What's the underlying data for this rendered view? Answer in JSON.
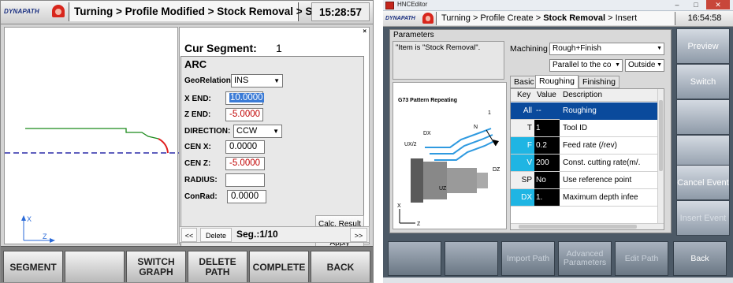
{
  "left": {
    "logo": "DYNAPATH",
    "breadcrumb": "Turning > Profile Modified > Stock Removal > Save",
    "clock": "15:28:57",
    "close": "×",
    "segment": {
      "label": "Cur Segment:",
      "value": "1"
    },
    "form": {
      "type": "ARC",
      "geo_label": "GeoRelation:",
      "geo_value": "INS",
      "xend_label": "X END:",
      "xend_value": "10.0000",
      "zend_label": "Z END:",
      "zend_value": "-5.0000",
      "dir_label": "DIRECTION:",
      "dir_value": "CCW",
      "cenx_label": "CEN X:",
      "cenx_value": "0.0000",
      "cenz_label": "CEN Z:",
      "cenz_value": "-5.0000",
      "radius_label": "RADIUS:",
      "radius_value": "",
      "conrad_label": "ConRad:",
      "conrad_value": "0.0000",
      "calc_button": "Calc. Result",
      "apply_button": "Apply"
    },
    "segnav": {
      "prev": "<<",
      "delete": "Delete",
      "seg": "Seg.:1/10",
      "next": ">>"
    },
    "axes": {
      "x": "X",
      "z": "Z"
    },
    "fkeys": [
      "SEGMENT",
      "",
      "SWITCH\nGRAPH",
      "DELETE\nPATH",
      "COMPLETE",
      "BACK"
    ]
  },
  "right": {
    "window_title": "HNCEditor",
    "logo": "DYNAPATH",
    "breadcrumb_pre": "Turning > Profile Create > ",
    "breadcrumb_bold": "Stock Removal",
    "breadcrumb_post": " > Insert",
    "clock": "16:54:58",
    "params_label": "Parameters",
    "info_text": "\"Item is \"Stock Removal\".",
    "machining_label": "Machining",
    "machining_value": "Rough+Finish",
    "parallel_value": "Parallel to the co",
    "side_value": "Outside",
    "tabs": [
      "Basic",
      "Roughing",
      "Finishing"
    ],
    "diagram": {
      "title": "G73 Pattern Repeating",
      "labels": {
        "dx": "DX",
        "ux2": "UX/2",
        "n": "N",
        "one": "1",
        "dz": "DZ",
        "uz": "UZ",
        "x": "X",
        "z": "Z"
      }
    },
    "table": {
      "headers": [
        "Key",
        "Value",
        "Description"
      ],
      "rows": [
        {
          "key": "All",
          "value": "--",
          "desc": "Roughing"
        },
        {
          "key": "T",
          "value": "1",
          "desc": "Tool ID"
        },
        {
          "key": "F",
          "value": "0.2",
          "desc": "Feed rate (/rev)"
        },
        {
          "key": "V",
          "value": "200",
          "desc": "Const. cutting rate(m/."
        },
        {
          "key": "SP",
          "value": "No",
          "desc": "Use reference point"
        },
        {
          "key": "DX",
          "value": "1.",
          "desc": "Maximum depth infee"
        }
      ]
    },
    "side_buttons": [
      "Preview",
      "Switch",
      "",
      "",
      "Cancel Event",
      "Insert Event"
    ],
    "fkeys": [
      "",
      "",
      "Import Path",
      "Advanced\nParameters",
      "Edit Path",
      "Back"
    ]
  }
}
